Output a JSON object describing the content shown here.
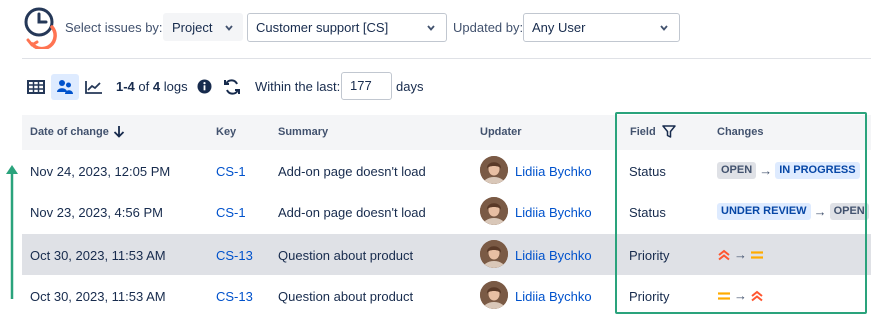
{
  "filters": {
    "select_issues_label": "Select issues by:",
    "select_issues_value": "Project",
    "project_value": "Customer support [CS]",
    "updated_by_label": "Updated by:",
    "updated_by_value": "Any User"
  },
  "toolbar": {
    "count_range": "1-4",
    "count_of": "of",
    "count_total": "4",
    "count_unit": "logs",
    "within_label": "Within the last:",
    "days_value": "177",
    "days_label": "days"
  },
  "table": {
    "headers": {
      "date": "Date of change",
      "key": "Key",
      "summary": "Summary",
      "updater": "Updater",
      "field": "Field",
      "changes": "Changes"
    },
    "rows": [
      {
        "date": "Nov 24, 2023, 12:05 PM",
        "key": "CS-1",
        "summary": "Add-on page doesn't load",
        "updater": "Lidiia Bychko",
        "field": "Status",
        "from": "OPEN",
        "to": "IN PROGRESS",
        "from_style": "grey",
        "to_style": "blue"
      },
      {
        "date": "Nov 23, 2023, 4:56 PM",
        "key": "CS-1",
        "summary": "Add-on page doesn't load",
        "updater": "Lidiia Bychko",
        "field": "Status",
        "from": "UNDER REVIEW",
        "to": "OPEN",
        "from_style": "blue",
        "to_style": "grey"
      },
      {
        "date": "Oct 30, 2023, 11:53 AM",
        "key": "CS-13",
        "summary": "Question about product",
        "updater": "Lidiia Bychko",
        "field": "Priority",
        "from_icon": "priority-high-icon",
        "to_icon": "priority-medium-icon",
        "selected": true
      },
      {
        "date": "Oct 30, 2023, 11:53 AM",
        "key": "CS-13",
        "summary": "Question about product",
        "updater": "Lidiia Bychko",
        "field": "Priority",
        "from_icon": "priority-medium-icon",
        "to_icon": "priority-high-icon"
      }
    ]
  },
  "colors": {
    "highlight_border": "#2aa37c",
    "link": "#0052cc",
    "priority_high": "#ff5630",
    "priority_medium": "#ffab00"
  }
}
